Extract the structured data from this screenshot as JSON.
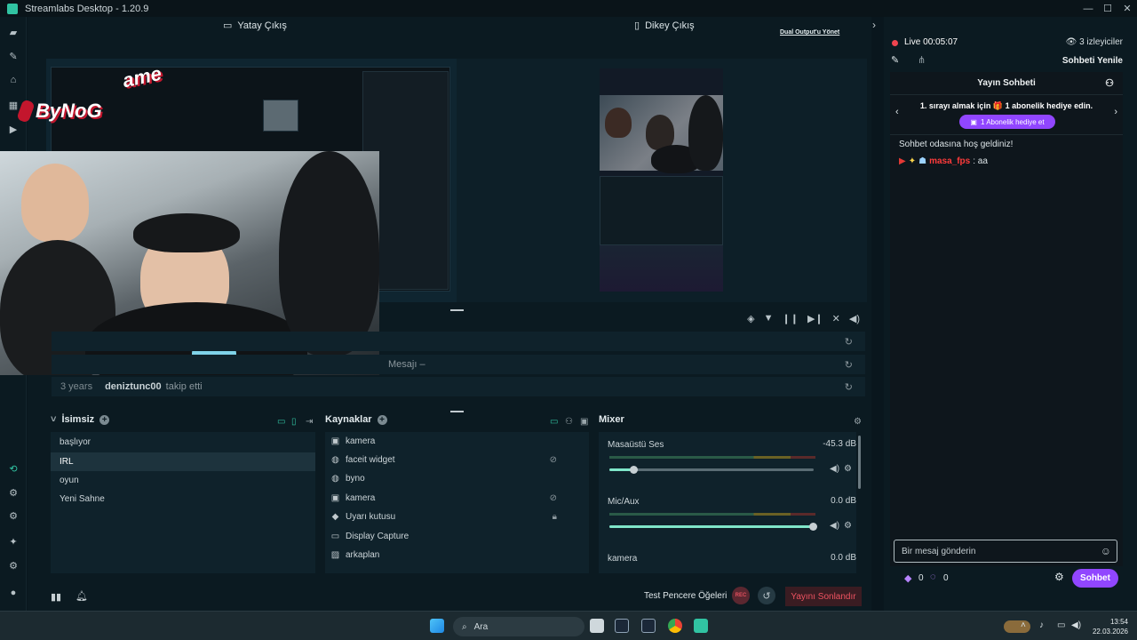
{
  "window": {
    "title": "Streamlabs Desktop - 1.20.9",
    "minimize": "—",
    "maximize": "☐",
    "close": "✕"
  },
  "preview": {
    "horizontal_label": "Yatay Çıkış",
    "vertical_label": "Dikey Çıkış",
    "dual_output_link": "Dual Output'u Yönet",
    "overlay_logo_top": "ame",
    "overlay_logo_bottom": "ByNoG"
  },
  "events": {
    "rows": [
      {
        "time": "",
        "user": "",
        "action": ""
      },
      {
        "time": "",
        "user": "",
        "action": "Mesajı –"
      },
      {
        "time": "3 years",
        "user": "deniztunc00",
        "action": "takip etti"
      }
    ]
  },
  "scenes": {
    "title": "İsimsiz",
    "items": [
      "başlıyor",
      "IRL",
      "oyun",
      "Yeni Sahne"
    ],
    "selected": "IRL"
  },
  "sources": {
    "title": "Kaynaklar",
    "items": [
      {
        "label": "kamera",
        "icon": "camera-icon"
      },
      {
        "label": "faceit widget",
        "icon": "globe-icon"
      },
      {
        "label": "byno",
        "icon": "globe-icon"
      },
      {
        "label": "kamera",
        "icon": "camera-icon"
      },
      {
        "label": "Uyarı kutusu",
        "icon": "alert-icon"
      },
      {
        "label": "Display Capture",
        "icon": "monitor-icon"
      },
      {
        "label": "arkaplan",
        "icon": "image-icon"
      }
    ]
  },
  "mixer": {
    "title": "Mixer",
    "channels": [
      {
        "name": "Masaüstü Ses",
        "db": "-45.3 dB",
        "level": 0.12
      },
      {
        "name": "Mic/Aux",
        "db": "0.0 dB",
        "level": 1.0
      },
      {
        "name": "kamera",
        "db": "0.0 dB",
        "level": 1.0
      }
    ]
  },
  "footer": {
    "test_widgets": "Test Pencere Öğeleri",
    "rec": "REC",
    "end_stream": "Yayını Sonlandır"
  },
  "live": {
    "status": "Live",
    "duration": "00:05:07",
    "viewers": "3 izleyiciler",
    "refresh_chat": "Sohbeti Yenile"
  },
  "chat": {
    "title": "Yayın Sohbeti",
    "gift_text": "1. sırayı almak için 🎁 1 abonelik hediye edin.",
    "gift_button": "1 Abonelik hediye et",
    "welcome": "Sohbet odasına hoş geldiniz!",
    "message_user": "masa_fps",
    "message_text": ": aa",
    "input_placeholder": "Bir mesaj gönderin",
    "points_a": "0",
    "points_b": "0",
    "send_button": "Sohbet"
  },
  "taskbar": {
    "search": "Ara",
    "time": "13:54",
    "date": "22.03.2026"
  },
  "colors": {
    "accent": "#31c3a2",
    "purple": "#9146ff",
    "danger": "#ef5361",
    "background": "#0b1a21"
  }
}
